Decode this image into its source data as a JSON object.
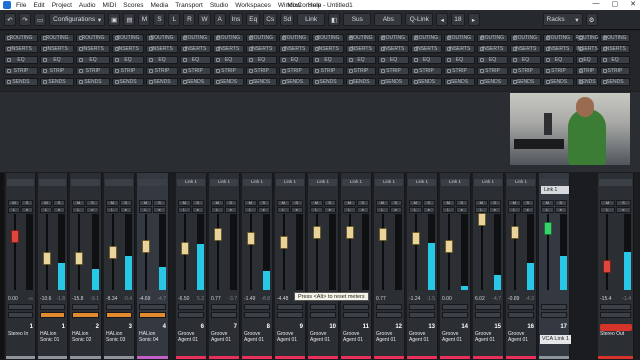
{
  "window": {
    "title": "MixConsole - Untitled1",
    "menu": [
      "File",
      "Edit",
      "Project",
      "Audio",
      "MIDI",
      "Scores",
      "Media",
      "Transport",
      "Studio",
      "Workspaces",
      "Window",
      "Help"
    ],
    "controls": [
      "—",
      "▢",
      "✕"
    ]
  },
  "toolbar": {
    "undo": "↶",
    "redo": "↷",
    "config_label": "Configurations",
    "letters": [
      "M",
      "S",
      "L",
      "R",
      "W",
      "A"
    ],
    "ins": "Ins",
    "eq": "Eq",
    "cs": "Cs",
    "sd": "Sd",
    "link": "Link",
    "sus": "Sus",
    "abs": "Abs",
    "qlink": "Q-Link",
    "count": "18",
    "racks": "Racks"
  },
  "rack_labels": {
    "routing": "ROUTING",
    "inserts": "INSERTS",
    "eq": "EQ",
    "strip": "STRIP",
    "sends": "SENDS"
  },
  "tooltip": "Press <Alt> to reset meters",
  "vca": {
    "label": "VCA Link 1",
    "link": "Link 1"
  },
  "channels": [
    {
      "num": "1",
      "name": "Stereo In",
      "reading": "0.00",
      "peak": "-∞",
      "fill": 0.0,
      "color": "#8d949c",
      "header": ""
    },
    {
      "num": "1",
      "name": "HALion Sonic 01",
      "reading": "-10.6",
      "peak": "-1.8",
      "fill": 0.35,
      "color": "#8d949c",
      "header": ""
    },
    {
      "num": "2",
      "name": "HALion Sonic 02",
      "reading": "-15.8",
      "peak": "-9.1",
      "fill": 0.28,
      "color": "#8d949c",
      "header": ""
    },
    {
      "num": "3",
      "name": "HALion Sonic 03",
      "reading": "-8.34",
      "peak": "-0.4",
      "fill": 0.45,
      "color": "#8d949c",
      "header": ""
    },
    {
      "num": "4",
      "name": "HALion Sonic 04",
      "reading": "-4.69",
      "peak": "-4.7",
      "fill": 0.3,
      "color": "#c45ec9",
      "header": ""
    },
    {
      "num": "6",
      "name": "Groove Agent 01",
      "reading": "-6.50",
      "peak": "5.2",
      "fill": 0.6,
      "color": "#e7315b",
      "header": "Link 1"
    },
    {
      "num": "7",
      "name": "Groove Agent 01",
      "reading": "0.77",
      "peak": "-3.7",
      "fill": 0.0,
      "color": "#e7315b",
      "header": "Link 1"
    },
    {
      "num": "8",
      "name": "Groove Agent 01",
      "reading": "-1.49",
      "peak": "-8.8",
      "fill": 0.25,
      "color": "#e7315b",
      "header": "Link 1"
    },
    {
      "num": "9",
      "name": "Groove Agent 01",
      "reading": "-4.48",
      "peak": "-5.3",
      "fill": 0.0,
      "color": "#e7315b",
      "header": "Link 1"
    },
    {
      "num": "10",
      "name": "Groove Agent 01",
      "reading": "0.77",
      "peak": "",
      "fill": 0.0,
      "color": "#e7315b",
      "header": "Link 1"
    },
    {
      "num": "11",
      "name": "Groove Agent 01",
      "reading": "",
      "peak": "",
      "fill": 0.0,
      "color": "#e7315b",
      "header": "Link 1"
    },
    {
      "num": "12",
      "name": "Groove Agent 01",
      "reading": "0.77",
      "peak": "",
      "fill": 0.0,
      "color": "#e7315b",
      "header": "Link 1"
    },
    {
      "num": "13",
      "name": "Groove Agent 01",
      "reading": "-1.24",
      "peak": "-1.5",
      "fill": 0.62,
      "color": "#e7315b",
      "header": "Link 1"
    },
    {
      "num": "14",
      "name": "Groove Agent 01",
      "reading": "0.00",
      "peak": "",
      "fill": 0.05,
      "color": "#e7315b",
      "header": "Link 1"
    },
    {
      "num": "15",
      "name": "Groove Agent 01",
      "reading": "6.02",
      "peak": "-4.7",
      "fill": 0.2,
      "color": "#e7315b",
      "header": "Link 1"
    },
    {
      "num": "16",
      "name": "Groove Agent 01",
      "reading": "-0.89",
      "peak": "-4.3",
      "fill": 0.35,
      "color": "#e7315b",
      "header": "Link 1"
    },
    {
      "num": "17",
      "name": "",
      "reading": "",
      "peak": "",
      "fill": 0.45,
      "color": "#8d949c",
      "header": ""
    },
    {
      "num": "",
      "name": "Stereo Out",
      "reading": "-15.4",
      "peak": "-1.4",
      "fill": 0.5,
      "color": "#d6332a",
      "header": ""
    }
  ]
}
